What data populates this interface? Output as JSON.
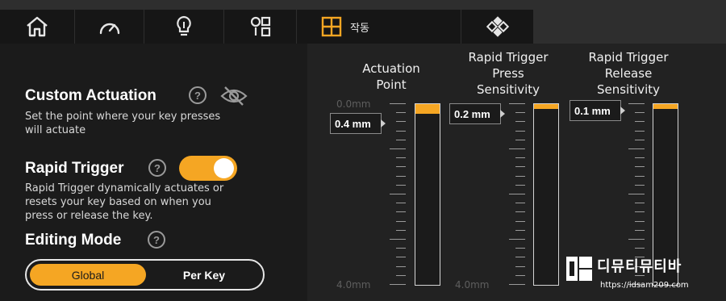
{
  "tabs": [
    {
      "id": "home",
      "icon": "home-icon"
    },
    {
      "id": "performance",
      "icon": "speedometer-icon"
    },
    {
      "id": "lighting",
      "icon": "lightbulb-icon"
    },
    {
      "id": "keymap",
      "icon": "layout-icon"
    },
    {
      "id": "actuation",
      "icon": "plus-square-icon",
      "label": "작동",
      "active": true
    },
    {
      "id": "advanced",
      "icon": "diamond-keys-icon"
    }
  ],
  "left": {
    "custom_actuation": {
      "title": "Custom Actuation",
      "description_line1": "Set the point where your key presses",
      "description_line2": "will actuate",
      "help_icon": "question-circle-icon",
      "visibility_icon": "eye-off-icon"
    },
    "rapid_trigger": {
      "title": "Rapid Trigger",
      "enabled": true,
      "description_line1": "Rapid Trigger dynamically actuates or",
      "description_line2": "resets your key based on when you",
      "description_line3": "press or release the key.",
      "help_icon": "question-circle-icon"
    },
    "editing_mode": {
      "title": "Editing Mode",
      "help_icon": "question-circle-icon",
      "options": [
        "Global",
        "Per Key"
      ],
      "selected": "Global"
    }
  },
  "right": {
    "scale_top": "0.0mm",
    "scale_bottom": "4.0mm",
    "columns": [
      {
        "header_line1": "Actuation",
        "header_line2": "Point",
        "header_line3": "",
        "value": "0.4 mm",
        "value_mm": 0.4
      },
      {
        "header_line1": "Rapid Trigger",
        "header_line2": "Press",
        "header_line3": "Sensitivity",
        "value": "0.2 mm",
        "value_mm": 0.2
      },
      {
        "header_line1": "Rapid Trigger",
        "header_line2": "Release",
        "header_line3": "Sensitivity",
        "value": "0.1 mm",
        "value_mm": 0.1
      }
    ]
  },
  "watermark": {
    "main": "디뮤티뮤티바",
    "url": "https://idsam209.com"
  },
  "colors": {
    "accent": "#f5a623",
    "tab_bar": "#2e2e2e",
    "tab_bg": "#161616",
    "left_bg": "#1b1b1b",
    "right_bg": "#222222"
  }
}
